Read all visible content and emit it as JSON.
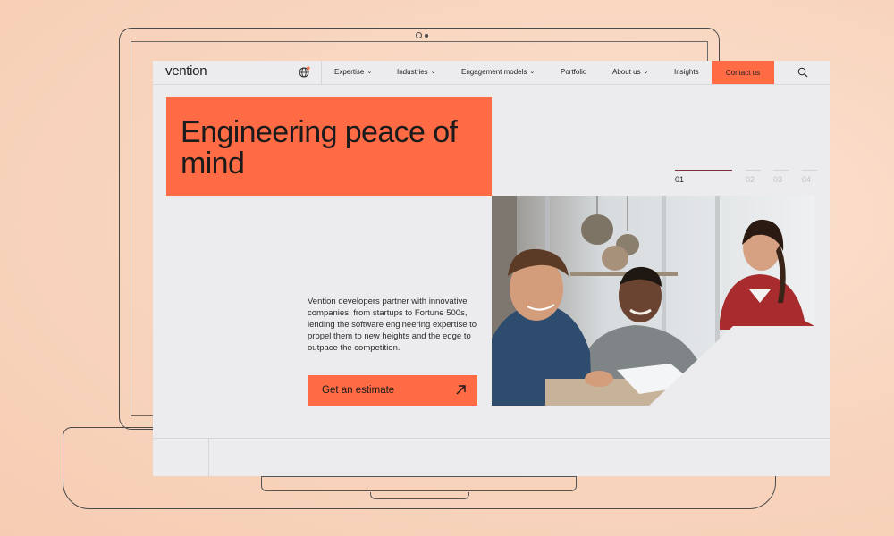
{
  "nav": {
    "logo": "vention",
    "items": [
      {
        "label": "Expertise",
        "has_dropdown": true
      },
      {
        "label": "Industries",
        "has_dropdown": true
      },
      {
        "label": "Engagement models",
        "has_dropdown": true
      },
      {
        "label": "Portfolio",
        "has_dropdown": false
      },
      {
        "label": "About us",
        "has_dropdown": true
      },
      {
        "label": "Insights",
        "has_dropdown": false
      }
    ],
    "contact_label": "Contact us",
    "icons": {
      "language": "globe-icon",
      "search": "search-icon",
      "dropdown": "chevron-down-icon"
    }
  },
  "hero": {
    "title": "Engineering peace of mind",
    "description": "Vention developers partner with innovative companies, from startups to Fortune 500s, lending the software engineering expertise to propel them to new heights and the edge to outpace the competition.",
    "cta_label": "Get an estimate",
    "cta_icon": "arrow-up-right-icon"
  },
  "slider": {
    "slides": [
      "01",
      "02",
      "03",
      "04"
    ],
    "active_index": 0
  },
  "colors": {
    "accent": "#ff6b45",
    "page_bg": "#ececee",
    "text": "#1e1e1e",
    "backdrop": "#f8d4bd"
  }
}
